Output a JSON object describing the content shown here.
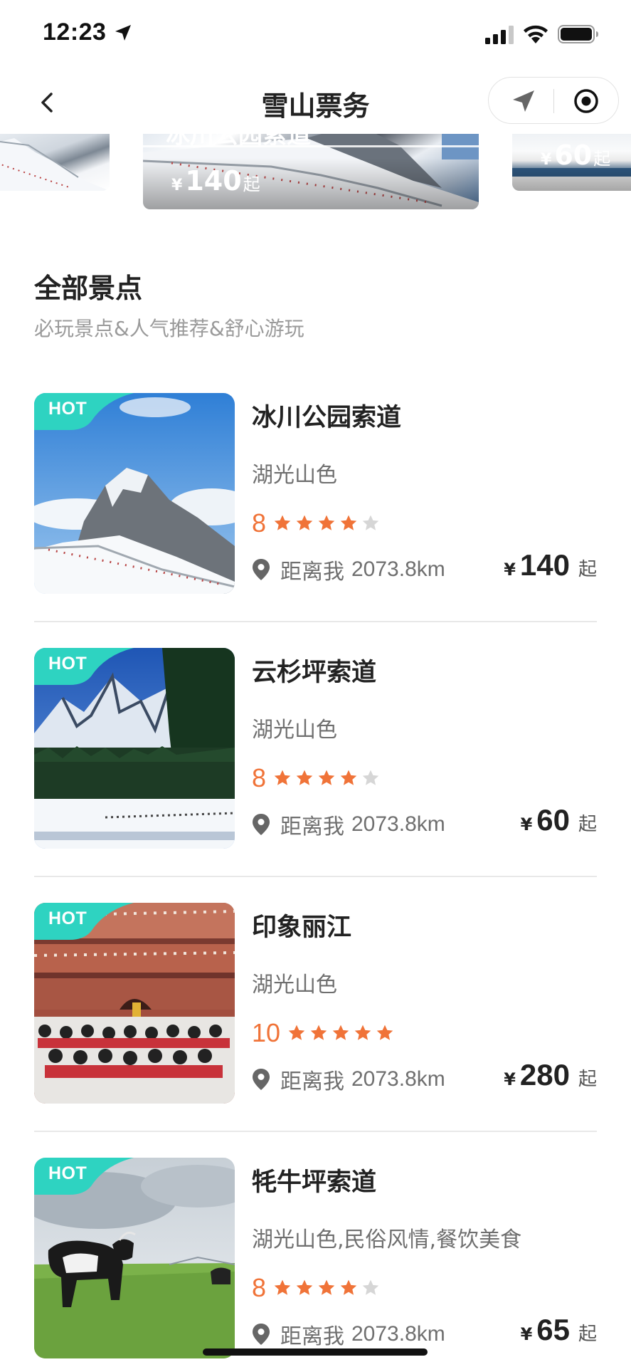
{
  "status_bar": {
    "time": "12:23"
  },
  "nav": {
    "title": "雪山票务"
  },
  "banners": [
    {
      "title": "冰川公园索道",
      "price": "140",
      "currency": "¥",
      "suffix": "起"
    },
    {
      "price": "60",
      "currency": "¥",
      "suffix": "起"
    }
  ],
  "section": {
    "title": "全部景点",
    "subtitle": "必玩景点&人气推荐&舒心游玩"
  },
  "colors": {
    "accent_orange": "#f07338",
    "hot_tag": "#2ed3c1",
    "star_off": "#d6d6d6"
  },
  "spots": [
    {
      "hot": "HOT",
      "name": "冰川公园索道",
      "tags": "湖光山色",
      "score": "8",
      "stars": 4,
      "distance_prefix": "距离我",
      "distance": "2073.8km",
      "currency": "¥",
      "price": "140",
      "suffix": "起"
    },
    {
      "hot": "HOT",
      "name": "云杉坪索道",
      "tags": "湖光山色",
      "score": "8",
      "stars": 4,
      "distance_prefix": "距离我",
      "distance": "2073.8km",
      "currency": "¥",
      "price": "60",
      "suffix": "起"
    },
    {
      "hot": "HOT",
      "name": "印象丽江",
      "tags": "湖光山色",
      "score": "10",
      "stars": 5,
      "distance_prefix": "距离我",
      "distance": "2073.8km",
      "currency": "¥",
      "price": "280",
      "suffix": "起"
    },
    {
      "hot": "HOT",
      "name": "牦牛坪索道",
      "tags": "湖光山色,民俗风情,餐饮美食",
      "score": "8",
      "stars": 4,
      "distance_prefix": "距离我",
      "distance": "2073.8km",
      "currency": "¥",
      "price": "65",
      "suffix": "起"
    }
  ]
}
